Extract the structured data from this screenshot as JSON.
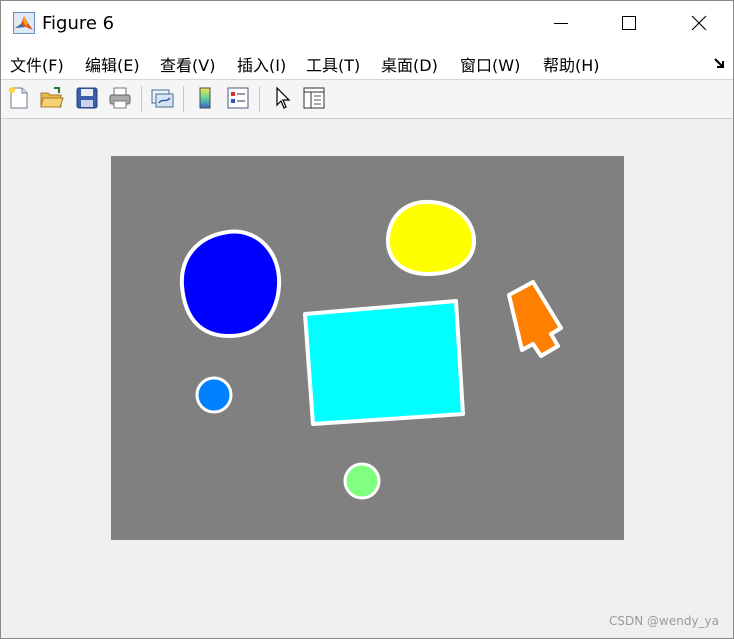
{
  "window": {
    "title": "Figure 6"
  },
  "menu": {
    "items": [
      {
        "label": "文件(F)"
      },
      {
        "label": "编辑(E)"
      },
      {
        "label": "查看(V)"
      },
      {
        "label": "插入(I)"
      },
      {
        "label": "工具(T)"
      },
      {
        "label": "桌面(D)"
      },
      {
        "label": "窗口(W)"
      },
      {
        "label": "帮助(H)"
      }
    ]
  },
  "toolbar": {
    "buttons": [
      {
        "icon": "new-figure-icon"
      },
      {
        "icon": "open-file-icon"
      },
      {
        "icon": "save-icon"
      },
      {
        "icon": "print-icon"
      },
      {
        "icon": "link-plot-icon"
      },
      {
        "icon": "colorbar-icon"
      },
      {
        "icon": "legend-icon"
      },
      {
        "icon": "pointer-icon"
      },
      {
        "icon": "property-inspector-icon"
      }
    ]
  },
  "figure": {
    "background": "#808080",
    "shapes": [
      {
        "name": "blue-blob",
        "color": "#0000ff"
      },
      {
        "name": "yellow-blob",
        "color": "#ffff00"
      },
      {
        "name": "orange-bottle",
        "color": "#ff8000"
      },
      {
        "name": "cyan-rectangle",
        "color": "#00ffff"
      },
      {
        "name": "azure-circle",
        "color": "#0080ff"
      },
      {
        "name": "lightgreen-circle",
        "color": "#80ff80"
      }
    ]
  },
  "watermark": "CSDN @wendy_ya"
}
